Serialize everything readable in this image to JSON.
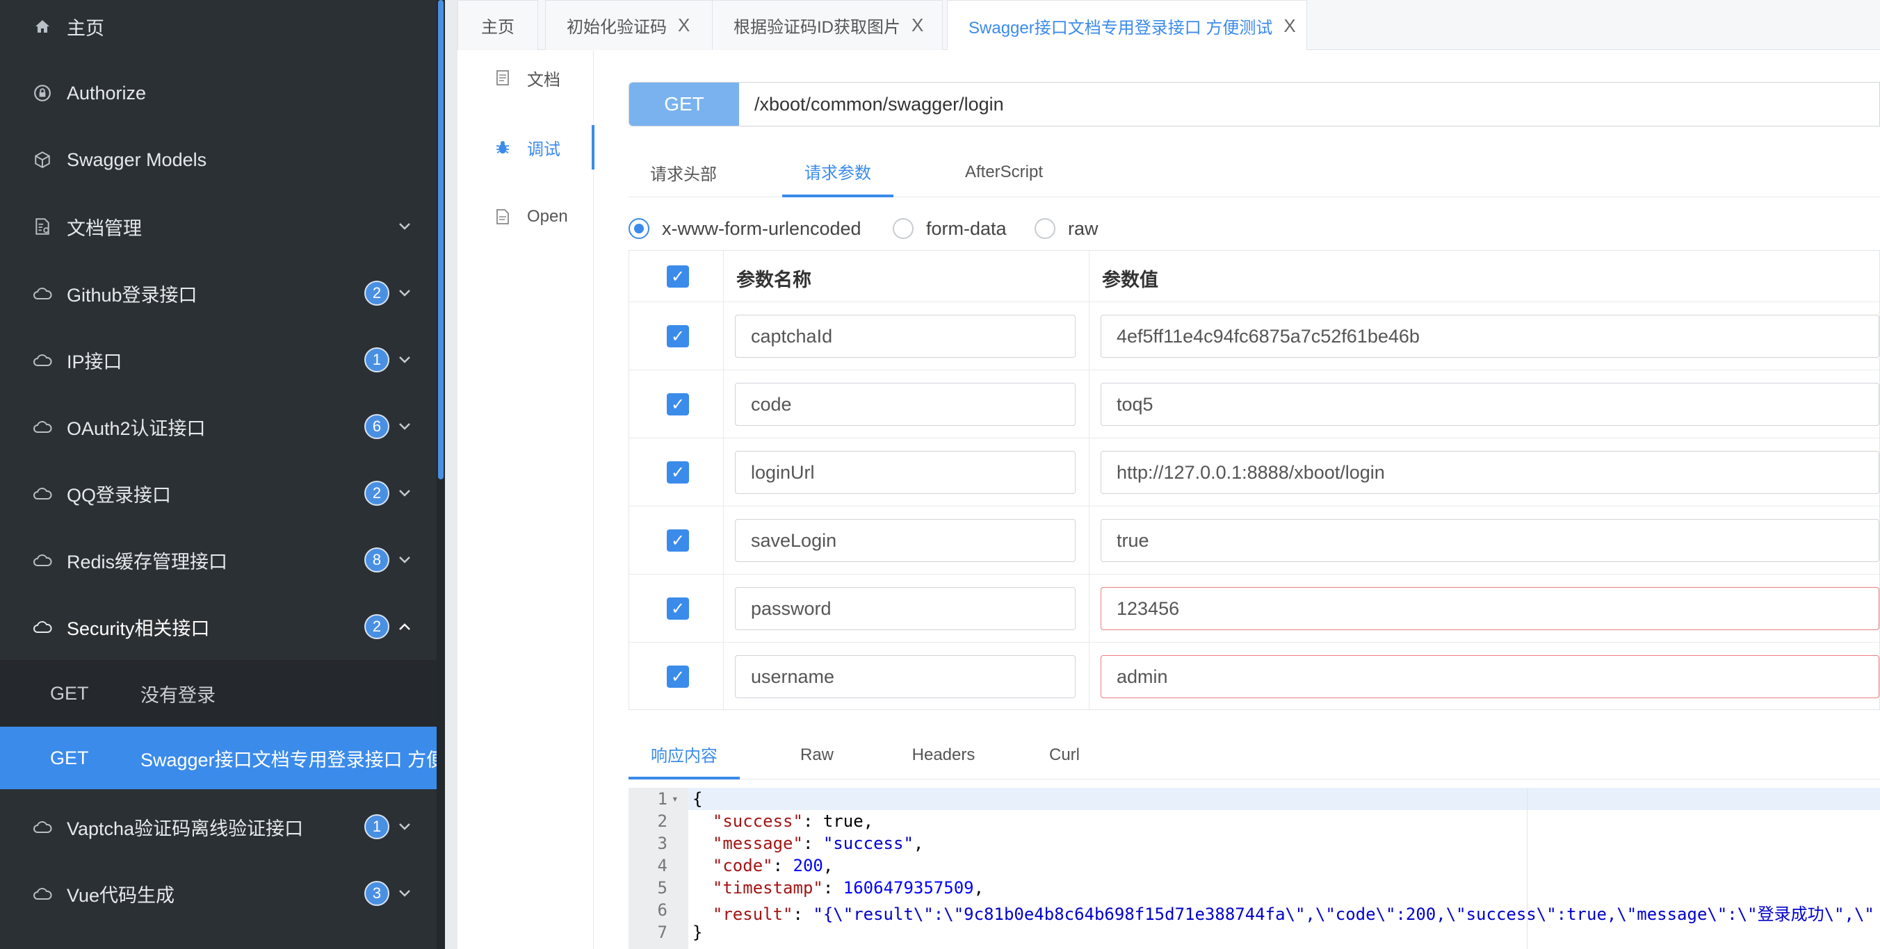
{
  "sidebar": {
    "items": [
      {
        "label": "主页",
        "icon": "home-icon"
      },
      {
        "label": "Authorize",
        "icon": "lock-icon"
      },
      {
        "label": "Swagger Models",
        "icon": "cube-icon"
      },
      {
        "label": "文档管理",
        "icon": "doc-manage-icon"
      },
      {
        "label": "Github登录接口",
        "icon": "cloud-icon",
        "badge": "2"
      },
      {
        "label": "IP接口",
        "icon": "cloud-icon",
        "badge": "1"
      },
      {
        "label": "OAuth2认证接口",
        "icon": "cloud-icon",
        "badge": "6"
      },
      {
        "label": "QQ登录接口",
        "icon": "cloud-icon",
        "badge": "2"
      },
      {
        "label": "Redis缓存管理接口",
        "icon": "cloud-icon",
        "badge": "8"
      },
      {
        "label": "Security相关接口",
        "icon": "cloud-icon",
        "badge": "2"
      },
      {
        "label": "Vaptcha验证码离线验证接口",
        "icon": "cloud-icon",
        "badge": "1"
      },
      {
        "label": "Vue代码生成",
        "icon": "cloud-icon",
        "badge": "3"
      }
    ],
    "sub_items": [
      {
        "method": "GET",
        "label": "没有登录"
      },
      {
        "method": "GET",
        "label": "Swagger接口文档专用登录接口 方便测试"
      }
    ]
  },
  "tabs": [
    {
      "label": "主页"
    },
    {
      "label": "初始化验证码",
      "close": "X"
    },
    {
      "label": "根据验证码ID获取图片",
      "close": "X"
    },
    {
      "label": "Swagger接口文档专用登录接口 方便测试",
      "close": "X"
    }
  ],
  "docnav": [
    {
      "label": "文档",
      "icon": "document-icon"
    },
    {
      "label": "调试",
      "icon": "bug-icon"
    },
    {
      "label": "Open",
      "icon": "file-icon"
    }
  ],
  "request": {
    "method": "GET",
    "url": "/xboot/common/swagger/login",
    "tabs": [
      "请求头部",
      "请求参数",
      "AfterScript"
    ],
    "content_types": [
      "x-www-form-urlencoded",
      "form-data",
      "raw"
    ],
    "table_headers": {
      "name": "参数名称",
      "value": "参数值"
    },
    "params": [
      {
        "name": "captchaId",
        "value": "4ef5ff11e4c94fc6875a7c52f61be46b"
      },
      {
        "name": "code",
        "value": "toq5"
      },
      {
        "name": "loginUrl",
        "value": "http://127.0.0.1:8888/xboot/login"
      },
      {
        "name": "saveLogin",
        "value": "true"
      },
      {
        "name": "password",
        "value": "123456"
      },
      {
        "name": "username",
        "value": "admin"
      }
    ]
  },
  "response": {
    "tabs": [
      "响应内容",
      "Raw",
      "Headers",
      "Curl"
    ],
    "line_numbers": [
      "1",
      "2",
      "3",
      "4",
      "5",
      "6",
      "7"
    ],
    "lines": {
      "l1": "{",
      "l2_key": "\"success\"",
      "l2_val": "true,",
      "l3_key": "\"message\"",
      "l3_val": "\"success\"",
      "l4_key": "\"code\"",
      "l4_val": "200",
      "l5_key": "\"timestamp\"",
      "l5_val": "1606479357509",
      "l6_key": "\"result\"",
      "l6_val": "\"{\\\"result\\\":\\\"9c81b0e4b8c64b698f15d71e388744fa\\\",\\\"code\\\":200,\\\"success\\\":true,\\\"message\\\":\\\"登录成功\\\",\\\"",
      "l7": "}"
    }
  }
}
